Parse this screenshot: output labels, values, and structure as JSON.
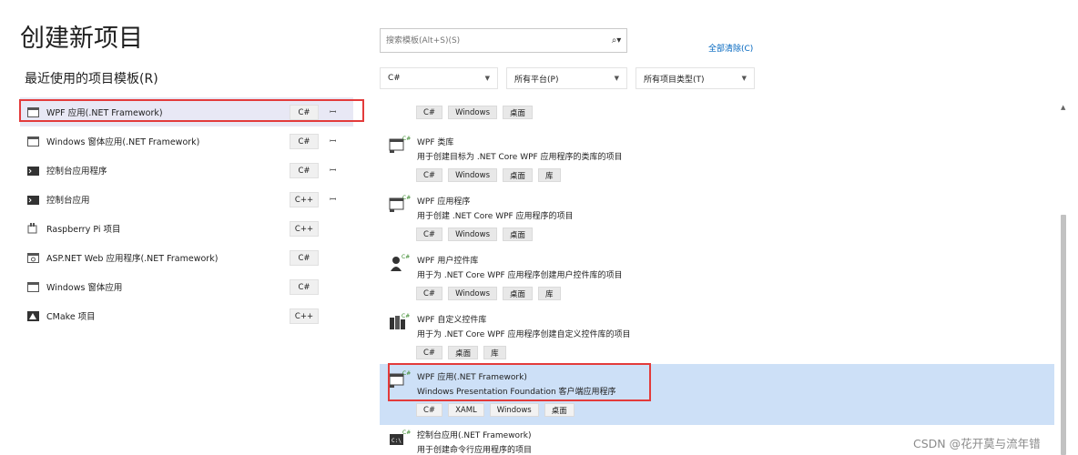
{
  "header": {
    "title": "创建新项目",
    "recent_title": "最近使用的项目模板(R)"
  },
  "recent_templates": [
    {
      "name": "WPF 应用(.NET Framework)",
      "lang": "C#",
      "pinned": true,
      "selected": true,
      "icon": "wpf-window-icon"
    },
    {
      "name": "Windows 窗体应用(.NET Framework)",
      "lang": "C#",
      "pinned": true,
      "selected": false,
      "icon": "window-icon"
    },
    {
      "name": "控制台应用程序",
      "lang": "C#",
      "pinned": true,
      "selected": false,
      "icon": "console-icon"
    },
    {
      "name": "控制台应用",
      "lang": "C++",
      "pinned": true,
      "selected": false,
      "icon": "console-icon"
    },
    {
      "name": "Raspberry Pi 项目",
      "lang": "C++",
      "pinned": false,
      "selected": false,
      "icon": "raspberry-icon"
    },
    {
      "name": "ASP.NET Web 应用程序(.NET Framework)",
      "lang": "C#",
      "pinned": false,
      "selected": false,
      "icon": "web-window-icon"
    },
    {
      "name": "Windows 窗体应用",
      "lang": "C#",
      "pinned": false,
      "selected": false,
      "icon": "window-icon"
    },
    {
      "name": "CMake 项目",
      "lang": "C++",
      "pinned": false,
      "selected": false,
      "icon": "cmake-icon"
    }
  ],
  "pin_glyph": "ꟷ",
  "search": {
    "placeholder": "搜索模板(Alt+S)(S)",
    "icon": "search-icon"
  },
  "clear_all_label": "全部清除(C)",
  "filters": {
    "language": "C#",
    "platform": "所有平台(P)",
    "project_type": "所有项目类型(T)"
  },
  "templates": [
    {
      "name": "",
      "desc": "",
      "tags": [
        "C#",
        "Windows",
        "桌面"
      ],
      "partial": true
    },
    {
      "name": "WPF 类库",
      "desc": "用于创建目标为 .NET Core WPF 应用程序的类库的项目",
      "tags": [
        "C#",
        "Windows",
        "桌面",
        "库"
      ],
      "icon": "wpf-library-icon"
    },
    {
      "name": "WPF 应用程序",
      "desc": "用于创建 .NET Core WPF 应用程序的项目",
      "tags": [
        "C#",
        "Windows",
        "桌面"
      ],
      "icon": "wpf-app-icon"
    },
    {
      "name": "WPF 用户控件库",
      "desc": "用于为 .NET Core WPF 应用程序创建用户控件库的项目",
      "tags": [
        "C#",
        "Windows",
        "桌面",
        "库"
      ],
      "icon": "wpf-user-control-icon"
    },
    {
      "name": "WPF 自定义控件库",
      "desc": "用于为 .NET Core WPF 应用程序创建自定义控件库的项目",
      "tags": [
        "C#",
        "桌面",
        "库"
      ],
      "icon": "wpf-custom-control-icon"
    },
    {
      "name": "WPF 应用(.NET Framework)",
      "desc": "Windows Presentation Foundation 客户端应用程序",
      "tags": [
        "C#",
        "XAML",
        "Windows",
        "桌面"
      ],
      "selected": true,
      "icon": "wpf-framework-icon"
    },
    {
      "name": "控制台应用(.NET Framework)",
      "desc": "用于创建命令行应用程序的项目",
      "tags": [],
      "icon": "console-app-icon"
    }
  ],
  "watermark": "CSDN @花开莫与流年错",
  "colors": {
    "accent_link": "#0066bf",
    "selection_blue": "#cde0f7",
    "highlight_red": "#e33b3b",
    "csharp_green": "#3c8a2e"
  }
}
